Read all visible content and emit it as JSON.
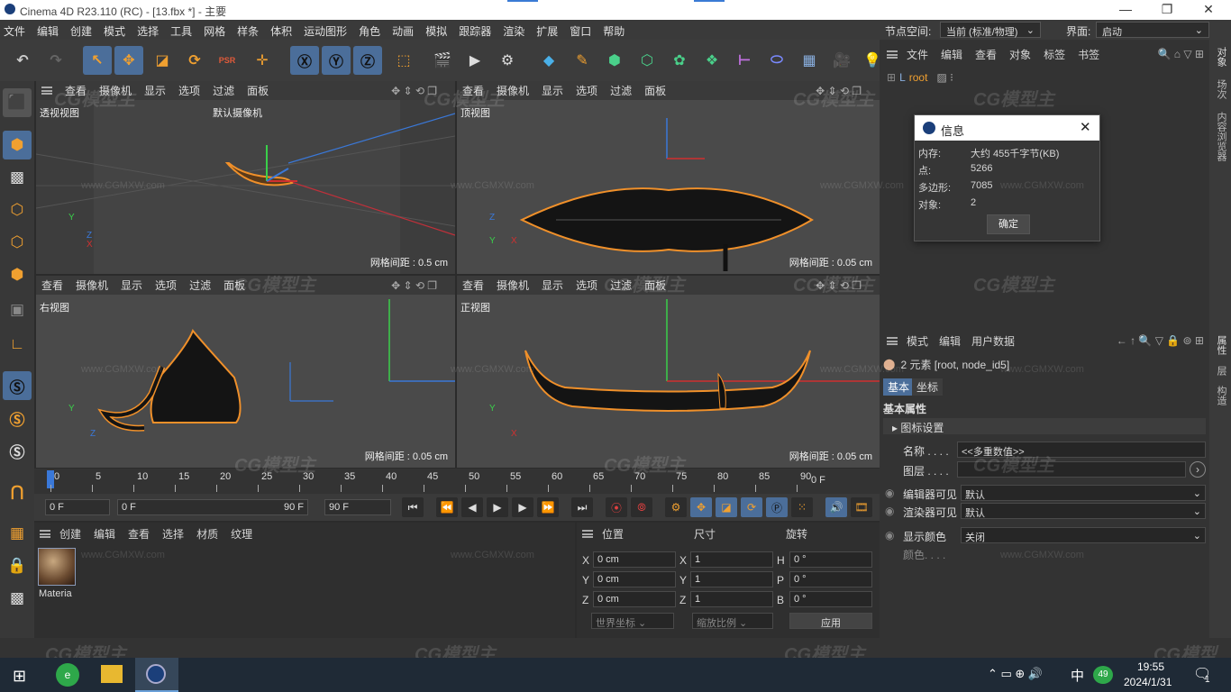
{
  "window": {
    "title": "Cinema 4D R23.110 (RC) - [13.fbx *] - 主要",
    "minimize": "—",
    "maximize": "❐",
    "close": "✕"
  },
  "menu": {
    "items": [
      "文件",
      "编辑",
      "创建",
      "模式",
      "选择",
      "工具",
      "网格",
      "样条",
      "体积",
      "运动图形",
      "角色",
      "动画",
      "模拟",
      "跟踪器",
      "渲染",
      "扩展",
      "窗口",
      "帮助"
    ],
    "node_space_label": "节点空间:",
    "node_space_value": "当前 (标准/物理)",
    "layout_label": "界面:",
    "layout_value": "启动"
  },
  "viewports": {
    "menu": [
      "查看",
      "摄像机",
      "显示",
      "选项",
      "过滤",
      "面板"
    ],
    "perspective": {
      "title": "透视视图",
      "camera": "默认摄像机",
      "grid": "网格间距 : 0.5 cm"
    },
    "top": {
      "title": "顶视图",
      "grid": "网格间距 : 0.05 cm"
    },
    "right": {
      "title": "右视图",
      "grid": "网格间距 : 0.05 cm"
    },
    "front": {
      "title": "正视图",
      "grid": "网格间距 : 0.05 cm"
    }
  },
  "axes": {
    "x": "X",
    "y": "Y",
    "z": "Z"
  },
  "timeline": {
    "ticks": [
      "0",
      "5",
      "10",
      "15",
      "20",
      "25",
      "30",
      "35",
      "40",
      "45",
      "50",
      "55",
      "60",
      "65",
      "70",
      "75",
      "80",
      "85",
      "90"
    ],
    "end_frame": "0 F"
  },
  "transport": {
    "current": "0 F",
    "range_start": "0 F",
    "range_end": "90 F",
    "max": "90 F"
  },
  "material": {
    "menu": [
      "创建",
      "编辑",
      "查看",
      "选择",
      "材质",
      "纹理"
    ],
    "item": "Materia"
  },
  "coords": {
    "headers": [
      "位置",
      "尺寸",
      "旋转"
    ],
    "rows": [
      {
        "axis": "X",
        "pos": "0 cm",
        "size_axis": "X",
        "size": "1",
        "rot_axis": "H",
        "rot": "0 °"
      },
      {
        "axis": "Y",
        "pos": "0 cm",
        "size_axis": "Y",
        "size": "1",
        "rot_axis": "P",
        "rot": "0 °"
      },
      {
        "axis": "Z",
        "pos": "0 cm",
        "size_axis": "Z",
        "size": "1",
        "rot_axis": "B",
        "rot": "0 °"
      }
    ],
    "world": "世界坐标",
    "scale": "缩放比例",
    "apply": "应用"
  },
  "objects": {
    "menu": [
      "文件",
      "编辑",
      "查看",
      "对象",
      "标签",
      "书签"
    ],
    "root": "root"
  },
  "info": {
    "title": "信息",
    "rows": [
      {
        "k": "内存:",
        "v": "大约 455千字节(KB)"
      },
      {
        "k": "点:",
        "v": "5266"
      },
      {
        "k": "多边形:",
        "v": "7085"
      },
      {
        "k": "对象:",
        "v": "2"
      }
    ],
    "ok": "确定"
  },
  "attributes": {
    "menu": [
      "模式",
      "编辑",
      "用户数据"
    ],
    "selection": "2 元素 [root, node_id5]",
    "tabs": [
      "基本",
      "坐标"
    ],
    "section": "基本属性",
    "group": "图标设置",
    "name_label": "名称 . . . .",
    "name_value": "<<多重数值>>",
    "layer_label": "图层 . . . .",
    "editor_label": "编辑器可见",
    "editor_value": "默认",
    "render_label": "渲染器可见",
    "render_value": "默认",
    "color_label": "显示颜色",
    "color_value": "关闭",
    "colour_label": "颜色. . . ."
  },
  "right_strip": {
    "tabs": [
      "对象",
      "场次",
      "内容浏览器"
    ],
    "tabs2": [
      "属性",
      "层",
      "构造"
    ]
  },
  "watermark": {
    "brand": "CG模型主",
    "site": "www.CGMXW.com"
  },
  "taskbar": {
    "time": "19:55",
    "date": "2024/1/31",
    "ime": "中",
    "badge": "49",
    "notif": "1"
  }
}
